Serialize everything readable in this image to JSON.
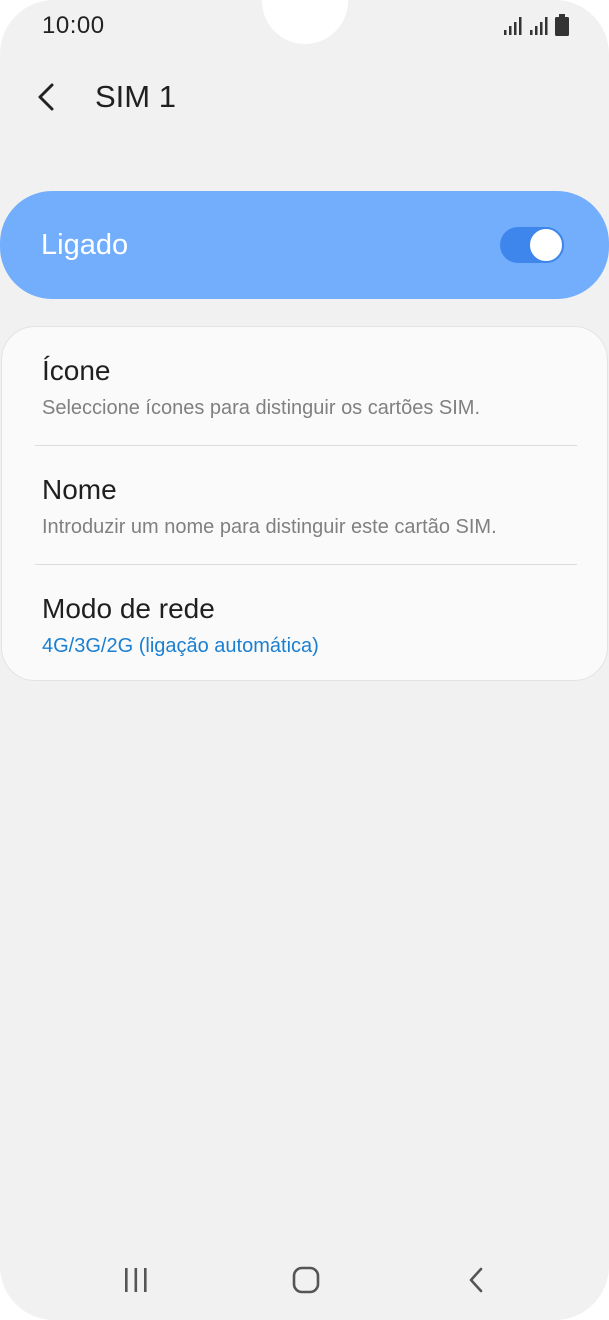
{
  "status_bar": {
    "time": "10:00",
    "icons": [
      "signal-sim1-icon",
      "signal-sim2-icon",
      "battery-icon"
    ]
  },
  "header": {
    "back_icon": "back-arrow-icon",
    "title": "SIM 1"
  },
  "master_toggle": {
    "label": "Ligado",
    "on": true,
    "color": "#73aefd",
    "switch_color": "#3e86ec"
  },
  "settings": [
    {
      "title": "Ícone",
      "subtitle": "Seleccione ícones para distinguir os cartões SIM."
    },
    {
      "title": "Nome",
      "subtitle": "Introduzir um nome para distinguir este cartão SIM."
    },
    {
      "title": "Modo de rede",
      "subtitle": "4G/3G/2G (ligação automática)",
      "subtitle_color": "#1a7fd1"
    }
  ],
  "nav_bar": {
    "buttons": [
      "recent-apps-icon",
      "home-icon",
      "back-icon"
    ]
  }
}
